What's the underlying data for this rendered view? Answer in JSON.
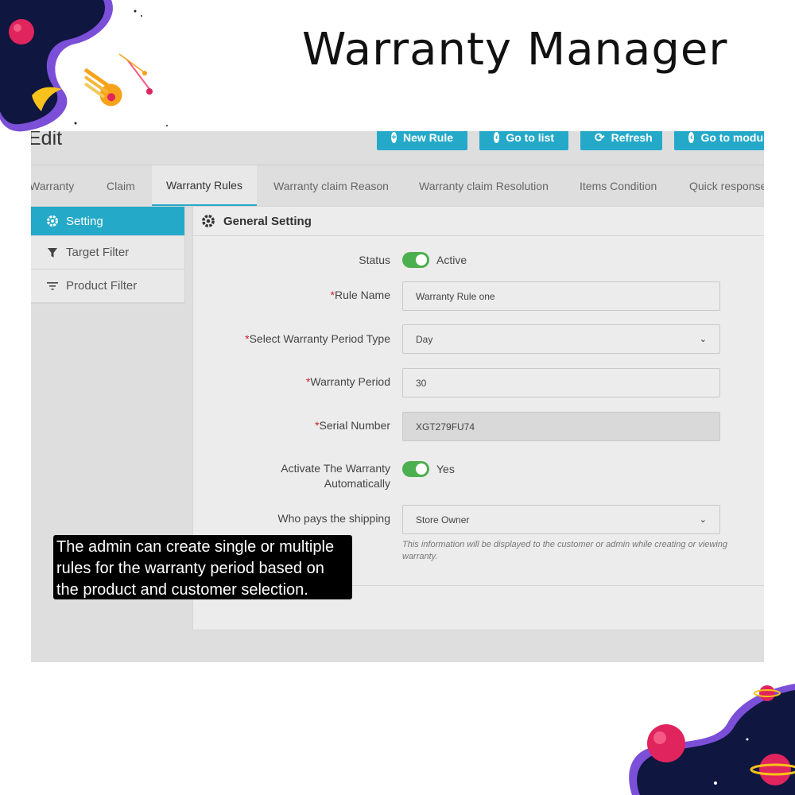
{
  "page_title": "Warranty Manager",
  "screenshot": {
    "heading": "Edit",
    "toolbar": [
      {
        "label": "New Rule",
        "icon": "plus-circle-icon"
      },
      {
        "label": "Go to list",
        "icon": "arrow-left-circle-icon"
      },
      {
        "label": "Refresh",
        "icon": "refresh-icon"
      },
      {
        "label": "Go to modu",
        "icon": "arrow-left-circle-icon"
      }
    ],
    "tabs": [
      {
        "label": "Warranty"
      },
      {
        "label": "Claim"
      },
      {
        "label": "Warranty Rules",
        "active": true
      },
      {
        "label": "Warranty claim Reason"
      },
      {
        "label": "Warranty claim Resolution"
      },
      {
        "label": "Items Condition"
      },
      {
        "label": "Quick response"
      }
    ],
    "sidebar": [
      {
        "label": "Setting",
        "icon": "gear-icon",
        "active": true
      },
      {
        "label": "Target Filter",
        "icon": "funnel-icon"
      },
      {
        "label": "Product Filter",
        "icon": "filter-lines-icon"
      }
    ],
    "panel": {
      "title": "General Setting",
      "status": {
        "label": "Status",
        "toggle_text": "Active",
        "on": true
      },
      "rule_name": {
        "required": "*",
        "label": "Rule Name",
        "value": "Warranty Rule one"
      },
      "period_type": {
        "required": "*",
        "label": "Select Warranty Period Type",
        "value": "Day"
      },
      "period": {
        "required": "*",
        "label": "Warranty Period",
        "value": "30"
      },
      "serial": {
        "required": "*",
        "label": "Serial Number",
        "value": "XGT279FU74"
      },
      "auto_activate": {
        "label_line1": "Activate The Warranty",
        "label_line2": "Automatically",
        "toggle_text": "Yes",
        "on": true
      },
      "shipping": {
        "label": "Who pays the shipping",
        "value": "Store Owner"
      },
      "help_text": "This information will be displayed to the customer or admin while creating or viewing warranty."
    }
  },
  "callout": "The admin can create single or multiple rules for the warranty period based on the product and customer selection.",
  "colors": {
    "accent": "#25a9c9",
    "toggle_on": "#4caf50",
    "required": "#d0202a",
    "deco_navy": "#0f1640",
    "deco_purple": "#7b4fd8",
    "deco_pink": "#e0245e",
    "deco_orange": "#f7a21b"
  }
}
